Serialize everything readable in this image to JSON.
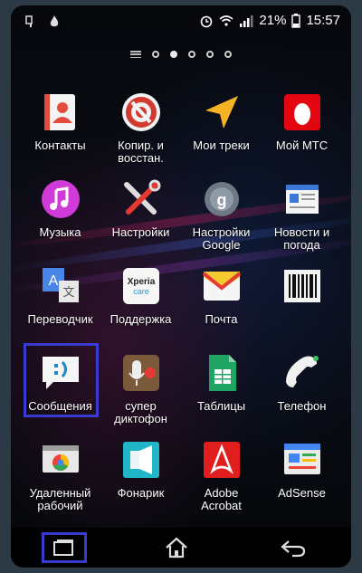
{
  "status": {
    "battery_percent": "21%",
    "time": "15:57"
  },
  "pager": {
    "pages": 5,
    "active": 1
  },
  "apps": [
    {
      "label": "Контакты",
      "icon": "contacts-icon"
    },
    {
      "label": "Копир. и\nвосстан.",
      "icon": "backup-icon"
    },
    {
      "label": "Мои треки",
      "icon": "tracks-icon"
    },
    {
      "label": "Мой МТС",
      "icon": "mts-icon"
    },
    {
      "label": "Музыка",
      "icon": "music-icon"
    },
    {
      "label": "Настройки",
      "icon": "settings-icon"
    },
    {
      "label": "Настройки\nGoogle",
      "icon": "google-settings-icon"
    },
    {
      "label": "Новости и\nпогода",
      "icon": "news-icon"
    },
    {
      "label": "Переводчик",
      "icon": "translate-icon"
    },
    {
      "label": "Поддержка",
      "icon": "xperia-care-icon"
    },
    {
      "label": "Почта",
      "icon": "mail-icon"
    },
    {
      "label": "",
      "icon": "barcode-icon"
    },
    {
      "label": "Сообщения",
      "icon": "messages-icon"
    },
    {
      "label": "супер\nдиктофон",
      "icon": "recorder-icon"
    },
    {
      "label": "Таблицы",
      "icon": "sheets-icon"
    },
    {
      "label": "Телефон",
      "icon": "phone-icon"
    },
    {
      "label": "Удаленный\nрабочий",
      "icon": "remote-desktop-icon"
    },
    {
      "label": "Фонарик",
      "icon": "flashlight-icon"
    },
    {
      "label": "Adobe\nAcrobat",
      "icon": "acrobat-icon"
    },
    {
      "label": "AdSense",
      "icon": "adsense-icon"
    }
  ],
  "xperia_care": {
    "line1": "Xperia",
    "line2": "care"
  },
  "colors": {
    "highlight": "#3a3ad0"
  }
}
